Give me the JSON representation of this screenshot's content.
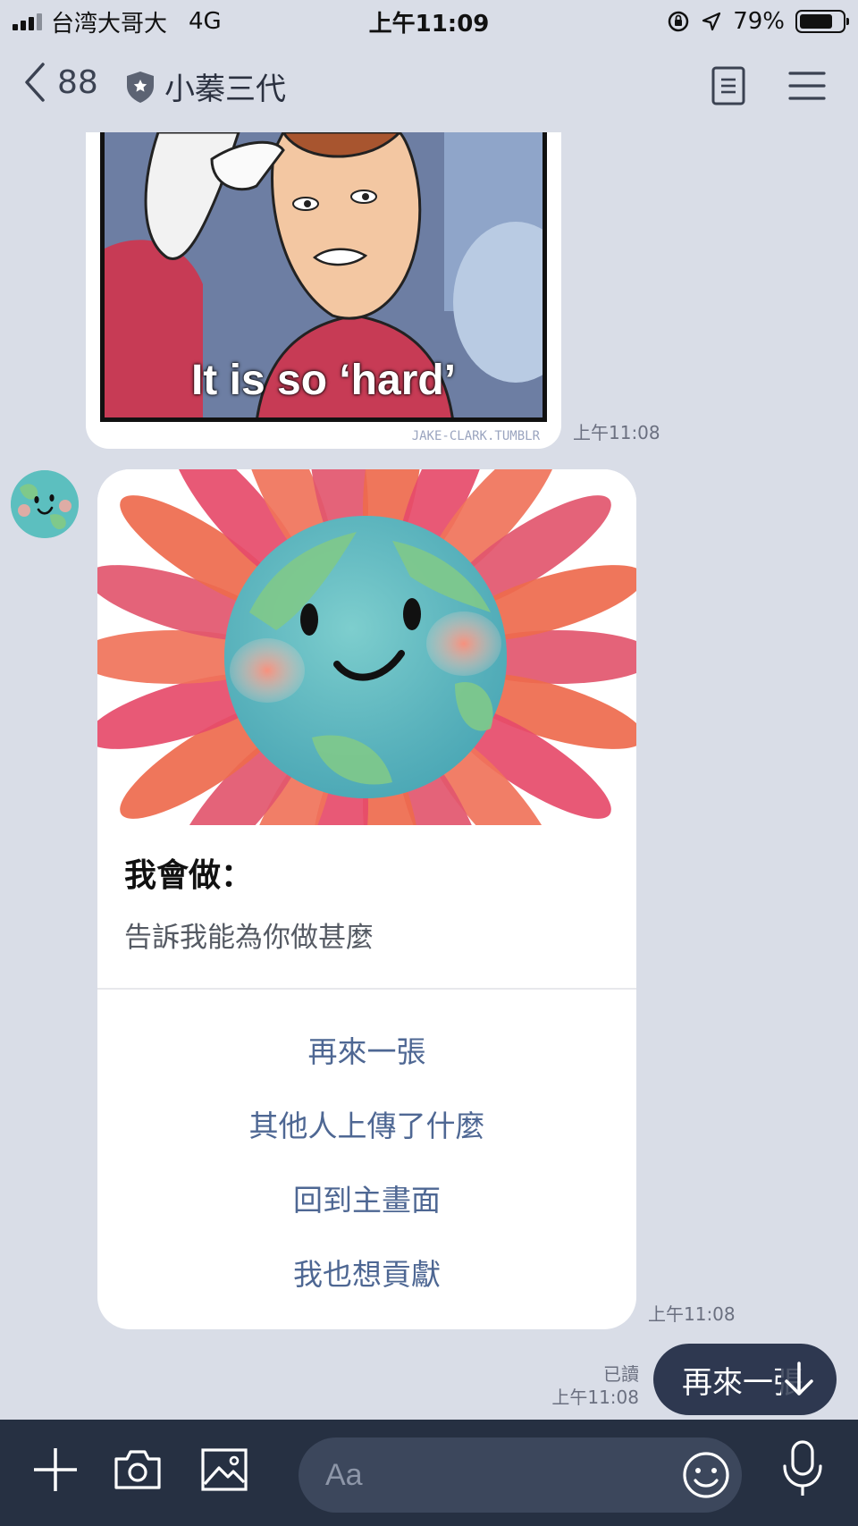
{
  "status_bar": {
    "carrier": "台湾大哥大",
    "network": "4G",
    "time": "上午11:09",
    "battery": "79%",
    "battery_level": 0.79
  },
  "nav": {
    "back_count": "88",
    "title": "小蓁三代",
    "icons": [
      "chevron-left-icon",
      "shield-icon",
      "notes-icon",
      "menu-icon"
    ]
  },
  "messages": {
    "meme": {
      "caption": "It is so ‘hard’",
      "credit": "JAKE-CLARK.TUMBLR",
      "timestamp": "上午11:08"
    },
    "card": {
      "title": "我會做：",
      "subtitle": "告訴我能為你做甚麼",
      "actions": [
        "再來一張",
        "其他人上傳了什麼",
        "回到主畫面",
        "我也想貢獻"
      ],
      "timestamp": "上午11:08"
    },
    "read_receipt": {
      "label": "已讀",
      "timestamp": "上午11:08"
    }
  },
  "quick_reply": {
    "label": "再來一張",
    "icon": "arrow-down-icon"
  },
  "input_bar": {
    "placeholder": "Aa",
    "icons": [
      "plus-icon",
      "camera-icon",
      "image-icon",
      "emoji-icon",
      "microphone-icon"
    ]
  },
  "colors": {
    "chat_background": "#d9dde7",
    "input_bar": "#263042",
    "action_text": "#4e6793",
    "quick_reply_bg": "#2e3850"
  }
}
